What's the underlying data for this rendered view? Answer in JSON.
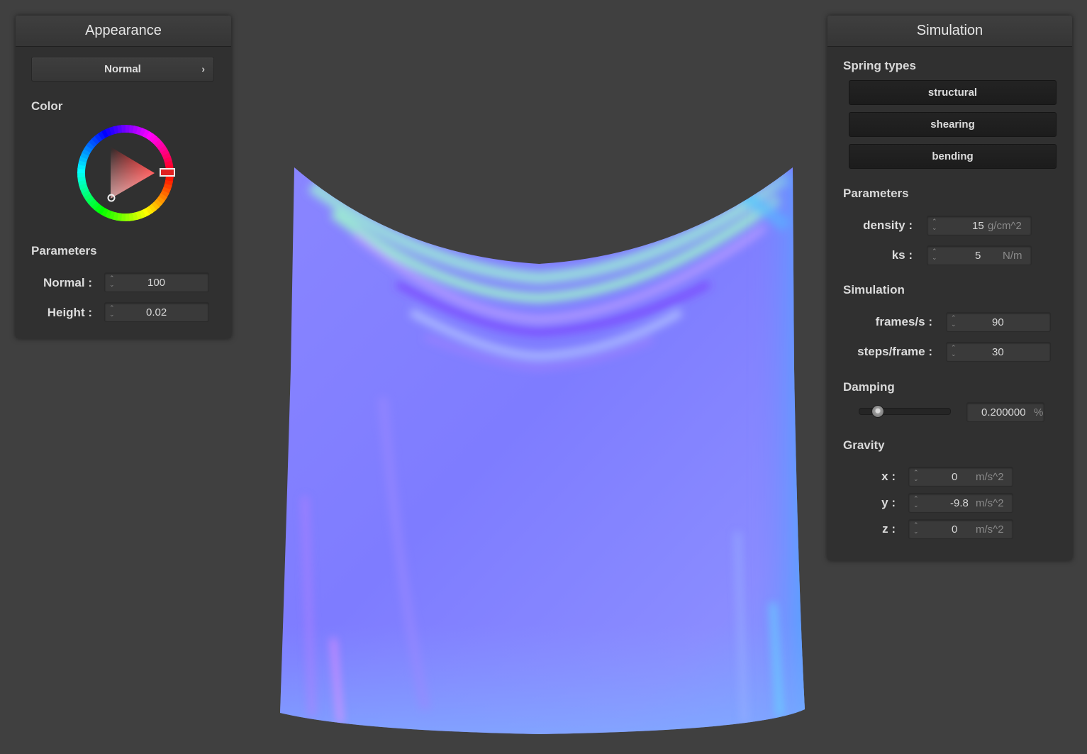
{
  "appearance": {
    "title": "Appearance",
    "mode_button": "Normal",
    "color_label": "Color",
    "color_value": "#e02020",
    "params_label": "Parameters",
    "normal_label": "Normal :",
    "normal_value": "100",
    "height_label": "Height :",
    "height_value": "0.02"
  },
  "simulation": {
    "title": "Simulation",
    "spring_types_label": "Spring types",
    "spring_types": [
      "structural",
      "shearing",
      "bending"
    ],
    "params_label": "Parameters",
    "density_label": "density :",
    "density_value": "15",
    "density_unit": "g/cm^2",
    "ks_label": "ks :",
    "ks_value": "5",
    "ks_unit": "N/m",
    "sim_label": "Simulation",
    "fps_label": "frames/s :",
    "fps_value": "90",
    "steps_label": "steps/frame :",
    "steps_value": "30",
    "damping_label": "Damping",
    "damping_value": "0.200000",
    "damping_unit": "%",
    "damping_level": 0.2,
    "gravity_label": "Gravity",
    "gx_label": "x :",
    "gx_value": "0",
    "gy_label": "y :",
    "gy_value": "-9.8",
    "gz_label": "z :",
    "gz_value": "0",
    "gravity_unit": "m/s^2"
  },
  "colors": {
    "background": "#404040",
    "panel": "#303030",
    "cloth_base": "#7f7fff"
  }
}
